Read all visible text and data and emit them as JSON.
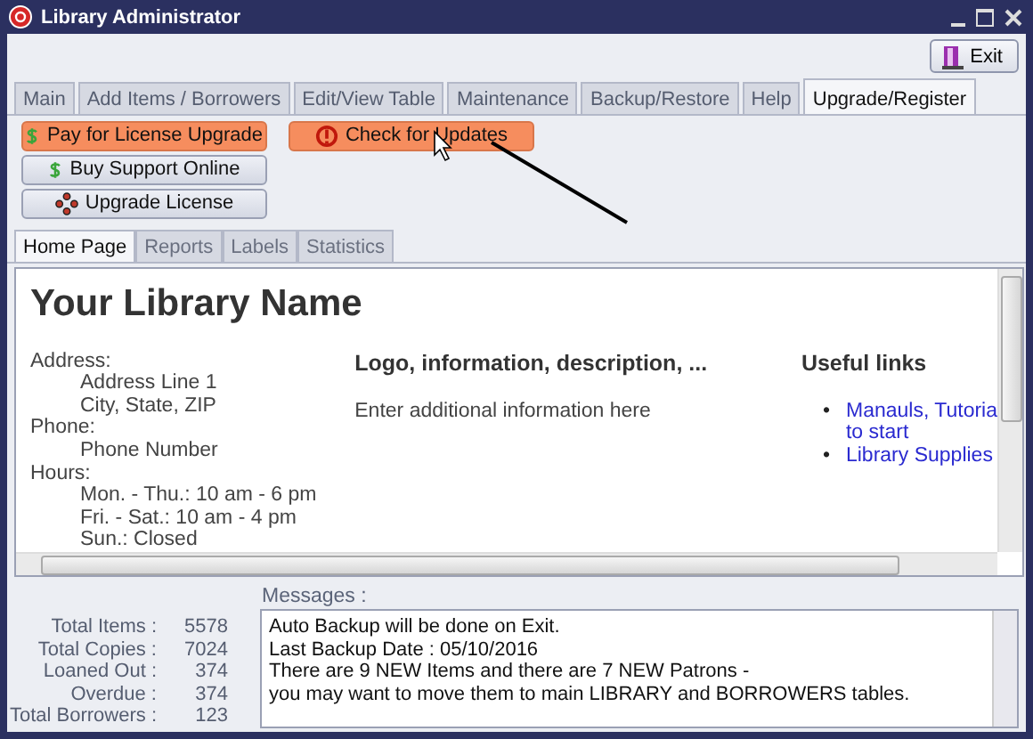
{
  "window": {
    "title": "Library Administrator"
  },
  "exit_button": {
    "label": "Exit"
  },
  "tabs": [
    {
      "label": "Main",
      "selected": false
    },
    {
      "label": "Add Items / Borrowers",
      "selected": false
    },
    {
      "label": "Edit/View Table",
      "selected": false
    },
    {
      "label": "Maintenance",
      "selected": false
    },
    {
      "label": "Backup/Restore",
      "selected": false
    },
    {
      "label": "Help",
      "selected": false
    },
    {
      "label": "Upgrade/Register",
      "selected": true
    }
  ],
  "actions": [
    {
      "label": "Pay for License Upgrade",
      "kind": "payment",
      "highlighted": true
    },
    {
      "label": "Buy Support Online",
      "kind": "payment",
      "highlighted": false
    },
    {
      "label": "Upgrade License",
      "kind": "upgrade",
      "highlighted": false
    },
    {
      "label": "Check for Updates",
      "kind": "update",
      "highlighted": true
    }
  ],
  "subtabs": [
    {
      "label": "Home Page",
      "selected": true
    },
    {
      "label": "Reports",
      "selected": false
    },
    {
      "label": "Labels",
      "selected": false
    },
    {
      "label": "Statistics",
      "selected": false
    }
  ],
  "home_page": {
    "heading": "Your Library Name",
    "contact": [
      {
        "kind": "label",
        "text": "Address:"
      },
      {
        "kind": "value",
        "text": "Address Line 1"
      },
      {
        "kind": "value",
        "text": "City, State, ZIP"
      },
      {
        "kind": "label",
        "text": "Phone:"
      },
      {
        "kind": "value",
        "text": "Phone Number"
      },
      {
        "kind": "label",
        "text": "Hours:"
      },
      {
        "kind": "value",
        "text": "Mon. - Thu.: 10 am - 6 pm"
      },
      {
        "kind": "value",
        "text": "Fri. - Sat.: 10 am - 4 pm"
      },
      {
        "kind": "value",
        "text": "Sun.: Closed"
      }
    ],
    "info_heading": "Logo, information, description, ...",
    "info_text": "Enter additional information here",
    "links_heading": "Useful links",
    "links": [
      {
        "marker": "•",
        "lines": [
          "Manauls, Tutoria",
          "to start"
        ]
      },
      {
        "marker": "•",
        "lines": [
          "Library Supplies"
        ]
      }
    ]
  },
  "stats": [
    {
      "label": "Total Items :",
      "value": "5578"
    },
    {
      "label": "Total Copies :",
      "value": "7024"
    },
    {
      "label": "Loaned Out :",
      "value": "374"
    },
    {
      "label": "Overdue :",
      "value": "374"
    },
    {
      "label": "Total Borrowers :",
      "value": "123"
    }
  ],
  "messages": {
    "label": "Messages :",
    "lines": [
      "Auto Backup will be done on Exit.",
      "Last Backup Date : 05/10/2016",
      "There are 9 NEW Items and there are 7 NEW Patrons -",
      "you may want to move them to main LIBRARY and BORROWERS tables."
    ]
  }
}
